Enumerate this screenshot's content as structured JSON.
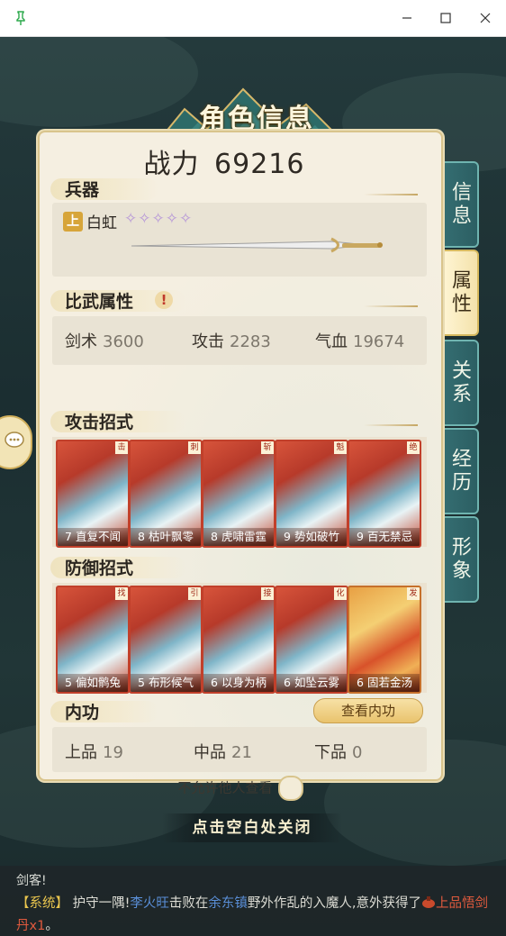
{
  "window": {
    "pin_icon": "pin-icon",
    "minimize": "minimize-icon",
    "maximize": "maximize-icon",
    "close": "close-icon"
  },
  "header": {
    "title": "角色信息"
  },
  "combat": {
    "label": "战力",
    "value": "69216"
  },
  "weapon": {
    "section_label": "兵器",
    "grade_tag": "上",
    "name": "白虹",
    "stars": "✧✧✧✧✧",
    "star_count": 5
  },
  "duel_attributes": {
    "section_label": "比武属性",
    "warning_icon": "!",
    "stats": [
      {
        "label": "剑术",
        "value": "3600"
      },
      {
        "label": "攻击",
        "value": "2283"
      },
      {
        "label": "气血",
        "value": "19674"
      }
    ]
  },
  "attack_moves": {
    "section_label": "攻击招式",
    "cards": [
      {
        "corner": "击",
        "caption": "7 直复不闻"
      },
      {
        "corner": "刺",
        "caption": "8 枯叶飘零"
      },
      {
        "corner": "斩",
        "caption": "8 虎啸雷霆"
      },
      {
        "corner": "魁",
        "caption": "9 势如破竹"
      },
      {
        "corner": "绝",
        "caption": "9 百无禁忌"
      }
    ]
  },
  "defense_moves": {
    "section_label": "防御招式",
    "cards": [
      {
        "corner": "找",
        "caption": "5 偏如鹘兔"
      },
      {
        "corner": "引",
        "caption": "5 布形候气"
      },
      {
        "corner": "接",
        "caption": "6 以身为柄"
      },
      {
        "corner": "化",
        "caption": "6 如坠云雾"
      },
      {
        "corner": "发",
        "caption": "6 固若金汤"
      }
    ]
  },
  "inner_power": {
    "section_label": "内功",
    "view_button": "查看内功",
    "grades": [
      {
        "label": "上品",
        "value": "19"
      },
      {
        "label": "中品",
        "value": "21"
      },
      {
        "label": "下品",
        "value": "0"
      }
    ]
  },
  "privacy": {
    "label": "不允许他人查看",
    "enabled": false
  },
  "tabs": [
    {
      "label": "信息",
      "active": false
    },
    {
      "label": "属性",
      "active": true
    },
    {
      "label": "关系",
      "active": false
    },
    {
      "label": "经历",
      "active": false
    },
    {
      "label": "形象",
      "active": false
    }
  ],
  "close_hint": "点击空白处关闭",
  "chat": {
    "line1": "剑客!",
    "system_tag": "【系统】",
    "part1": "护守一隅!",
    "player_name": "李火旺",
    "part2": "击败在",
    "place": "余东镇",
    "part3": "野外作乱的入魔人,意外获得了",
    "item": "上品悟剑丹x1",
    "part4": "。"
  },
  "colors": {
    "accent_teal": "#2c5f63",
    "panel_bg": "#f5efe1",
    "gold": "#d7a53a",
    "card_red": "#c1402b"
  }
}
